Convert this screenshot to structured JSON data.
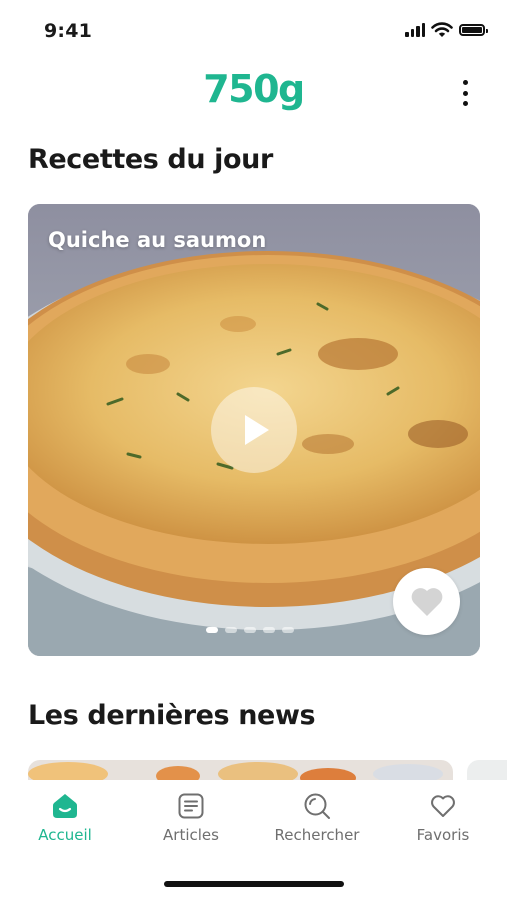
{
  "status_bar": {
    "time": "9:41"
  },
  "header": {
    "logo": "750g"
  },
  "sections": {
    "recipes_title": "Recettes du jour",
    "news_title": "Les dernières news"
  },
  "recipe_card": {
    "title": "Quiche au saumon",
    "slide_count": 5,
    "active_slide": 1
  },
  "tabs": [
    {
      "label": "Accueil",
      "icon": "home-icon",
      "active": true
    },
    {
      "label": "Articles",
      "icon": "articles-icon",
      "active": false
    },
    {
      "label": "Rechercher",
      "icon": "search-icon",
      "active": false
    },
    {
      "label": "Favoris",
      "icon": "heart-icon",
      "active": false
    }
  ],
  "colors": {
    "accent": "#1fb690",
    "inactive": "#6f6f6f",
    "text": "#1a1a1a"
  }
}
